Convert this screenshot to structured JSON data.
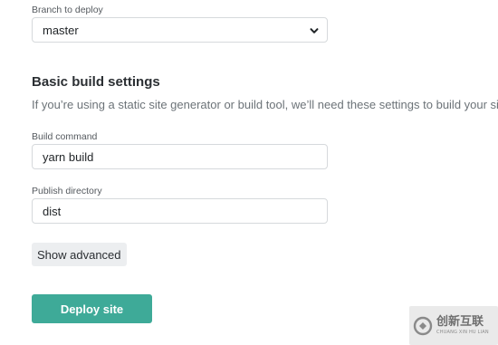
{
  "branch": {
    "label": "Branch to deploy",
    "value": "master"
  },
  "build_settings": {
    "title": "Basic build settings",
    "description": "If you’re using a static site generator or build tool, we’ll need these settings to build your si"
  },
  "build_command": {
    "label": "Build command",
    "value": "yarn build"
  },
  "publish_directory": {
    "label": "Publish directory",
    "value": "dist"
  },
  "buttons": {
    "show_advanced": "Show advanced",
    "deploy_site": "Deploy site"
  },
  "colors": {
    "primary": "#3eaa98",
    "secondary_bg": "#eceef0"
  },
  "watermark": {
    "text": "创新互联",
    "subtext": "CHUANG XIN HU LIAN",
    "icon": "watermark-logo-icon"
  }
}
